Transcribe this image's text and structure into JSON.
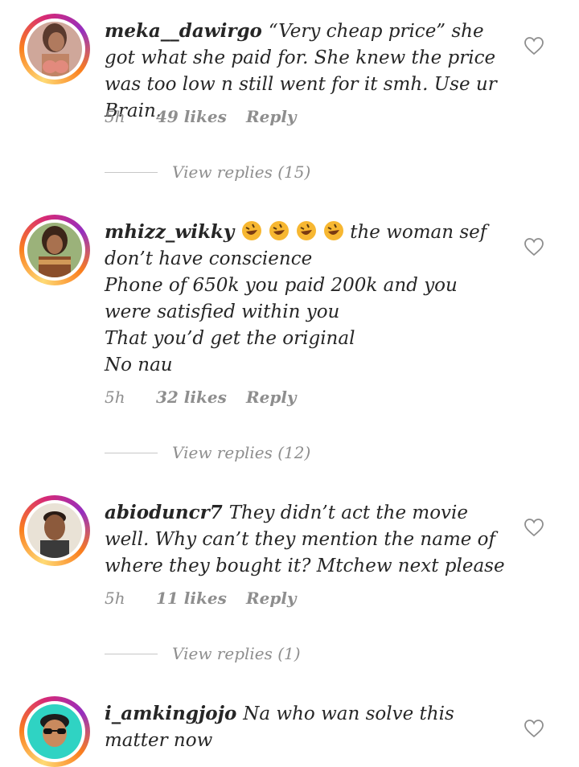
{
  "comments": [
    {
      "username": "meka__dawirgo",
      "text": "“Very cheap price” she got what she paid for. She knew the price was too low n still went for it smh. Use ur Brain.",
      "time": "5h",
      "likes": "49 likes",
      "reply_label": "Reply",
      "view_replies": "View replies (15)"
    },
    {
      "username": "mhizz_wikky",
      "emoji": [
        "rofl-emoji",
        "rofl-emoji",
        "rofl-emoji",
        "rofl-emoji"
      ],
      "text": "the woman sef don’t have conscience\nPhone of 650k you paid 200k and you were satisfied within you\nThat you’d get the original\nNo nau",
      "time": "5h",
      "likes": "32 likes",
      "reply_label": "Reply",
      "view_replies": "View replies (12)"
    },
    {
      "username": "abioduncr7",
      "text": "They didn’t act the movie well. Why can’t they mention the name of where they bought it? Mtchew next please",
      "time": "5h",
      "likes": "11 likes",
      "reply_label": "Reply",
      "view_replies": "View replies (1)"
    },
    {
      "username": "i_amkingjojo",
      "text": "Na who wan solve this matter now"
    }
  ],
  "colors": {
    "text": "#262626",
    "muted": "#8e8e8e",
    "ring_start": "#feda75",
    "ring_mid": "#d62976",
    "ring_end": "#962fbf"
  },
  "icons": {
    "like": "heart-outline-icon",
    "emoji": "rolling-on-floor-laughing"
  }
}
